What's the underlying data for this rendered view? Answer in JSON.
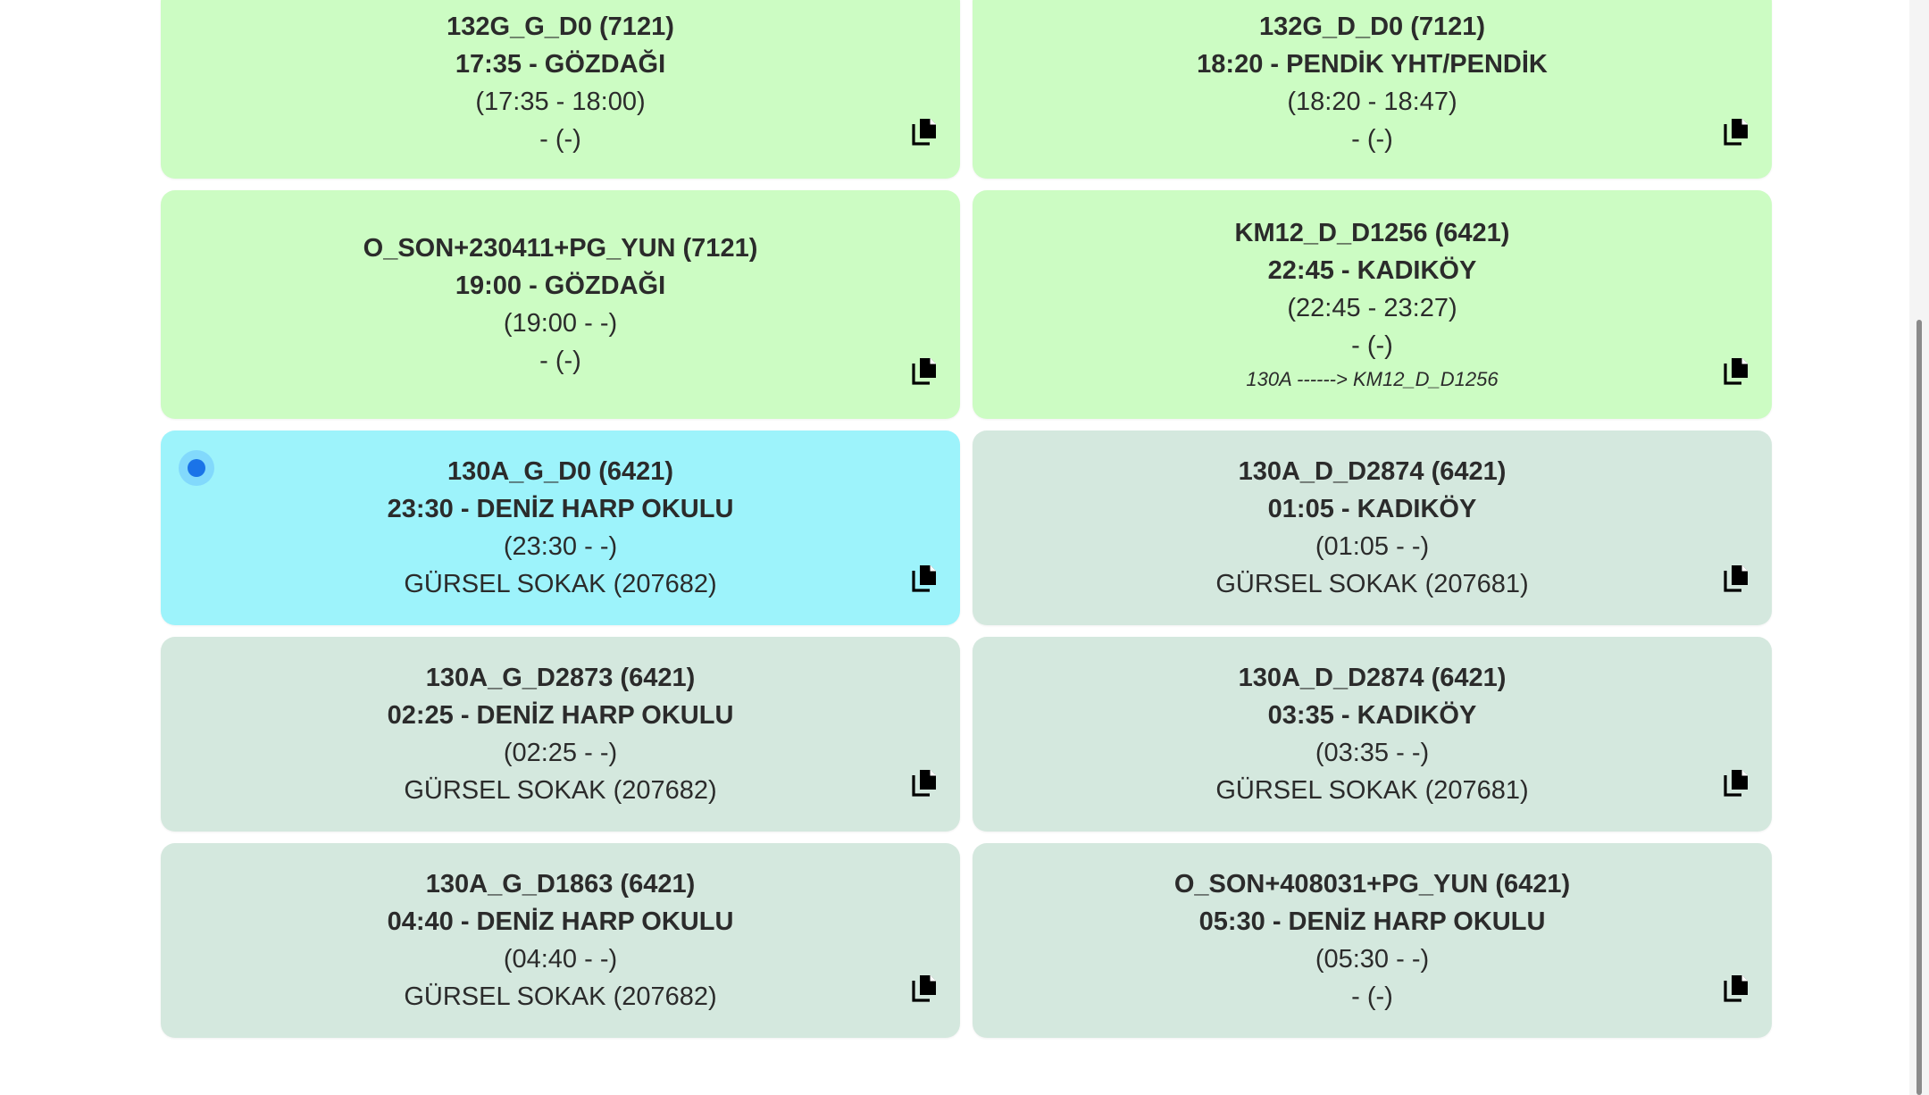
{
  "cards": [
    {
      "variant": "green",
      "code": "132G_G_D0 (7121)",
      "head": "17:35 - GÖZDAĞI",
      "range": "(17:35 - 18:00)",
      "stop": "- (-)",
      "note": "",
      "selected": false,
      "icon": "copy-icon"
    },
    {
      "variant": "green",
      "code": "132G_D_D0 (7121)",
      "head": "18:20 - PENDİK YHT/PENDİK",
      "range": "(18:20 - 18:47)",
      "stop": "- (-)",
      "note": "",
      "selected": false,
      "icon": "copy-icon"
    },
    {
      "variant": "green",
      "code": "O_SON+230411+PG_YUN (7121)",
      "head": "19:00 - GÖZDAĞI",
      "range": "(19:00 - -)",
      "stop": "- (-)",
      "note": "",
      "selected": false,
      "icon": "copy-icon"
    },
    {
      "variant": "green",
      "code": "KM12_D_D1256 (6421)",
      "head": "22:45 - KADIKÖY",
      "range": "(22:45 - 23:27)",
      "stop": "- (-)",
      "note": "130A ------> KM12_D_D1256",
      "selected": false,
      "icon": "copy-icon"
    },
    {
      "variant": "cyan",
      "code": "130A_G_D0 (6421)",
      "head": "23:30 - DENİZ HARP OKULU",
      "range": "(23:30 - -)",
      "stop": "GÜRSEL SOKAK (207682)",
      "note": "",
      "selected": true,
      "icon": "copy-icon"
    },
    {
      "variant": "gray",
      "code": "130A_D_D2874 (6421)",
      "head": "01:05 - KADIKÖY",
      "range": "(01:05 - -)",
      "stop": "GÜRSEL SOKAK (207681)",
      "note": "",
      "selected": false,
      "icon": "copy-icon"
    },
    {
      "variant": "gray",
      "code": "130A_G_D2873 (6421)",
      "head": "02:25 - DENİZ HARP OKULU",
      "range": "(02:25 - -)",
      "stop": "GÜRSEL SOKAK (207682)",
      "note": "",
      "selected": false,
      "icon": "copy-icon"
    },
    {
      "variant": "gray",
      "code": "130A_D_D2874 (6421)",
      "head": "03:35 - KADIKÖY",
      "range": "(03:35 - -)",
      "stop": "GÜRSEL SOKAK (207681)",
      "note": "",
      "selected": false,
      "icon": "copy-icon"
    },
    {
      "variant": "gray",
      "code": "130A_G_D1863 (6421)",
      "head": "04:40 - DENİZ HARP OKULU",
      "range": "(04:40 - -)",
      "stop": "GÜRSEL SOKAK (207682)",
      "note": "",
      "selected": false,
      "icon": "copy-icon"
    },
    {
      "variant": "gray",
      "code": "O_SON+408031+PG_YUN (6421)",
      "head": "05:30 - DENİZ HARP OKULU",
      "range": "(05:30 - -)",
      "stop": "- (-)",
      "note": "",
      "selected": false,
      "icon": "copy-icon"
    }
  ],
  "colors": {
    "green": "#ccfcc3",
    "cyan": "#9df3fb",
    "gray": "#d4e8de",
    "selection": "#1a73e8"
  }
}
